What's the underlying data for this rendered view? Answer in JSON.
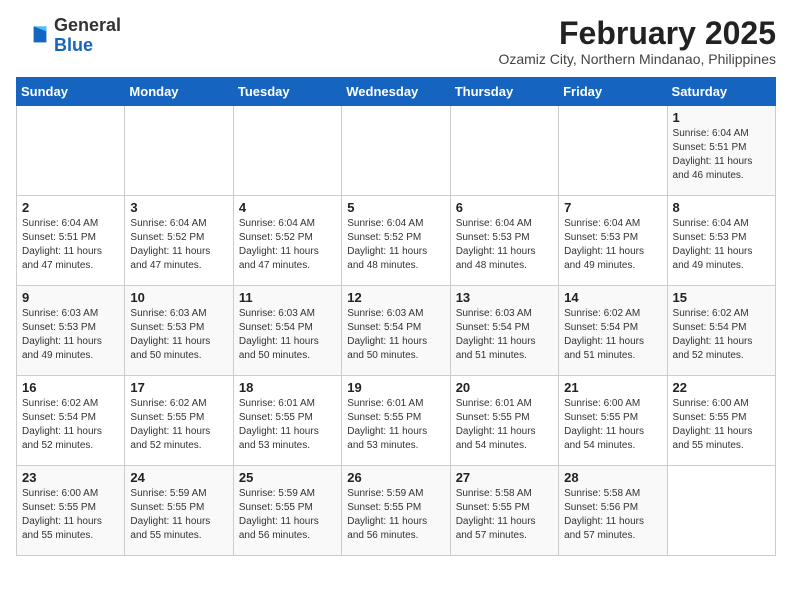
{
  "header": {
    "logo_general": "General",
    "logo_blue": "Blue",
    "month_year": "February 2025",
    "location": "Ozamiz City, Northern Mindanao, Philippines"
  },
  "days_of_week": [
    "Sunday",
    "Monday",
    "Tuesday",
    "Wednesday",
    "Thursday",
    "Friday",
    "Saturday"
  ],
  "weeks": [
    [
      {
        "day": "",
        "info": ""
      },
      {
        "day": "",
        "info": ""
      },
      {
        "day": "",
        "info": ""
      },
      {
        "day": "",
        "info": ""
      },
      {
        "day": "",
        "info": ""
      },
      {
        "day": "",
        "info": ""
      },
      {
        "day": "1",
        "info": "Sunrise: 6:04 AM\nSunset: 5:51 PM\nDaylight: 11 hours and 46 minutes."
      }
    ],
    [
      {
        "day": "2",
        "info": "Sunrise: 6:04 AM\nSunset: 5:51 PM\nDaylight: 11 hours and 47 minutes."
      },
      {
        "day": "3",
        "info": "Sunrise: 6:04 AM\nSunset: 5:52 PM\nDaylight: 11 hours and 47 minutes."
      },
      {
        "day": "4",
        "info": "Sunrise: 6:04 AM\nSunset: 5:52 PM\nDaylight: 11 hours and 47 minutes."
      },
      {
        "day": "5",
        "info": "Sunrise: 6:04 AM\nSunset: 5:52 PM\nDaylight: 11 hours and 48 minutes."
      },
      {
        "day": "6",
        "info": "Sunrise: 6:04 AM\nSunset: 5:53 PM\nDaylight: 11 hours and 48 minutes."
      },
      {
        "day": "7",
        "info": "Sunrise: 6:04 AM\nSunset: 5:53 PM\nDaylight: 11 hours and 49 minutes."
      },
      {
        "day": "8",
        "info": "Sunrise: 6:04 AM\nSunset: 5:53 PM\nDaylight: 11 hours and 49 minutes."
      }
    ],
    [
      {
        "day": "9",
        "info": "Sunrise: 6:03 AM\nSunset: 5:53 PM\nDaylight: 11 hours and 49 minutes."
      },
      {
        "day": "10",
        "info": "Sunrise: 6:03 AM\nSunset: 5:53 PM\nDaylight: 11 hours and 50 minutes."
      },
      {
        "day": "11",
        "info": "Sunrise: 6:03 AM\nSunset: 5:54 PM\nDaylight: 11 hours and 50 minutes."
      },
      {
        "day": "12",
        "info": "Sunrise: 6:03 AM\nSunset: 5:54 PM\nDaylight: 11 hours and 50 minutes."
      },
      {
        "day": "13",
        "info": "Sunrise: 6:03 AM\nSunset: 5:54 PM\nDaylight: 11 hours and 51 minutes."
      },
      {
        "day": "14",
        "info": "Sunrise: 6:02 AM\nSunset: 5:54 PM\nDaylight: 11 hours and 51 minutes."
      },
      {
        "day": "15",
        "info": "Sunrise: 6:02 AM\nSunset: 5:54 PM\nDaylight: 11 hours and 52 minutes."
      }
    ],
    [
      {
        "day": "16",
        "info": "Sunrise: 6:02 AM\nSunset: 5:54 PM\nDaylight: 11 hours and 52 minutes."
      },
      {
        "day": "17",
        "info": "Sunrise: 6:02 AM\nSunset: 5:55 PM\nDaylight: 11 hours and 52 minutes."
      },
      {
        "day": "18",
        "info": "Sunrise: 6:01 AM\nSunset: 5:55 PM\nDaylight: 11 hours and 53 minutes."
      },
      {
        "day": "19",
        "info": "Sunrise: 6:01 AM\nSunset: 5:55 PM\nDaylight: 11 hours and 53 minutes."
      },
      {
        "day": "20",
        "info": "Sunrise: 6:01 AM\nSunset: 5:55 PM\nDaylight: 11 hours and 54 minutes."
      },
      {
        "day": "21",
        "info": "Sunrise: 6:00 AM\nSunset: 5:55 PM\nDaylight: 11 hours and 54 minutes."
      },
      {
        "day": "22",
        "info": "Sunrise: 6:00 AM\nSunset: 5:55 PM\nDaylight: 11 hours and 55 minutes."
      }
    ],
    [
      {
        "day": "23",
        "info": "Sunrise: 6:00 AM\nSunset: 5:55 PM\nDaylight: 11 hours and 55 minutes."
      },
      {
        "day": "24",
        "info": "Sunrise: 5:59 AM\nSunset: 5:55 PM\nDaylight: 11 hours and 55 minutes."
      },
      {
        "day": "25",
        "info": "Sunrise: 5:59 AM\nSunset: 5:55 PM\nDaylight: 11 hours and 56 minutes."
      },
      {
        "day": "26",
        "info": "Sunrise: 5:59 AM\nSunset: 5:55 PM\nDaylight: 11 hours and 56 minutes."
      },
      {
        "day": "27",
        "info": "Sunrise: 5:58 AM\nSunset: 5:55 PM\nDaylight: 11 hours and 57 minutes."
      },
      {
        "day": "28",
        "info": "Sunrise: 5:58 AM\nSunset: 5:56 PM\nDaylight: 11 hours and 57 minutes."
      },
      {
        "day": "",
        "info": ""
      }
    ]
  ]
}
